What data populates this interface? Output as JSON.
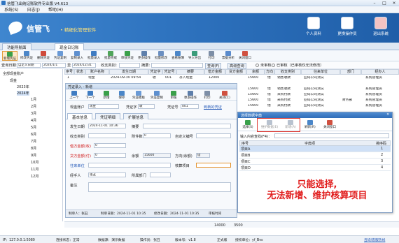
{
  "window": {
    "title": "信管飞出纳记账软件专业版 V4.613",
    "controls": [
      "–",
      "□",
      "×"
    ]
  },
  "menu": [
    "系统(S)",
    "日志(J)",
    "帮助(H)"
  ],
  "banner": {
    "brand": "信管飞",
    "slogan": "• 精细化管理软件",
    "buttons": [
      "个人资料",
      "更换操作员",
      "退出系统"
    ]
  },
  "tabs": [
    "功能导航面",
    "现金日记账"
  ],
  "toolbar": [
    "新增凭证",
    "修改凭证",
    "删除凭证",
    "凭证复制",
    "复制录入",
    "批量录入",
    "批量完成",
    "审核凭证",
    "更多操作",
    "批量修改",
    "查看账簿",
    "导入导出",
    "打印",
    "票据分析",
    "关闭窗口"
  ],
  "filter": {
    "period_label": "查询日期：",
    "period_value": "自定义日期",
    "date_from": "2024/1/1",
    "to_label": "至",
    "date_to": "2024/12/31",
    "class_label": "收支类别：",
    "summary_label": "摘要：",
    "query_btn": "查询(F)",
    "reset_btn": "高级查询",
    "unreviewed": "未审核",
    "reviewed": "已审核（已审核仅无法修改）"
  },
  "tree": {
    "root": "全部现金账户",
    "account": "现金",
    "years": [
      "2023年",
      "2024年"
    ],
    "months": [
      "1月",
      "2月",
      "3月",
      "4月",
      "5月",
      "6月",
      "7月",
      "8月",
      "9月",
      "10月",
      "11月",
      "12月"
    ]
  },
  "grid": {
    "headers": [
      "序号",
      "状态",
      "账户名称",
      "发生日期",
      "凭证字",
      "凭证号",
      "摘要",
      "借方金额",
      "贷方金额",
      "余额",
      "方向",
      "收支类别",
      "往来单位",
      "部门",
      "经办人"
    ],
    "first_row": [
      "1",
      "",
      "现金",
      "2024-09-30 09:54",
      "收",
      "001",
      "存入现金",
      "12000",
      "",
      "15600",
      "借",
      "销售收款",
      "亚码公司测试",
      "",
      "系统管理员"
    ],
    "right_rows": [
      [
        "15600",
        "借",
        "销售收款",
        "亚码公司测试",
        "",
        "系统管理员"
      ],
      [
        "15600",
        "借",
        "采购付款",
        "亚码公司测试",
        "",
        "系统管理员"
      ],
      [
        "15600",
        "借",
        "采购付款",
        "亚码公司测试",
        "财务部",
        "系统管理员"
      ],
      [
        "15600",
        "借",
        "采购付款",
        "亚码公司测试",
        "",
        "系统管理员"
      ]
    ]
  },
  "voucher": {
    "title": "凭证录入 - 新增",
    "toolbar": [
      "上一个",
      "下一个",
      "新增",
      "保存",
      "凭证模板",
      "凭证复制",
      "审核",
      "更多操作",
      "打印",
      "关闭(C)"
    ],
    "account_label": "现金账户",
    "account_value": "现金",
    "vword_label": "凭证字",
    "vword_value": "收",
    "vno_label": "凭证号",
    "vno_value": "001",
    "extra_link": "到新的凭证",
    "tabs": [
      "基本信息",
      "凭证明细",
      "扩展信息"
    ],
    "date_label": "发生日期",
    "date_value": "2024-11-01 10:36",
    "summary_label": "摘要",
    "class_label": "收支类别",
    "attach_label": "附件数",
    "attach_value": "0",
    "custom_label": "自定义编号",
    "debit_label": "借方金额(收)",
    "debit_value": "0",
    "credit_label": "贷方金额(付)",
    "credit_value": "0",
    "balance_label": "余额",
    "balance_value": "15600",
    "dir_label": "方向(余额)",
    "dir_value": "借",
    "partner_label": "往来单位",
    "settle_label": "核算项目",
    "handler_label": "经手人",
    "handler_value": "张丑",
    "dept_label": "所属部门",
    "remark_label": "备注",
    "footer_maker": "制单人：张丑",
    "footer_make_time": "制单日期：2024-11-01 10:35",
    "footer_modify_time": "修改日期：2024-11-01 10:35",
    "footer_review": "审核时间"
  },
  "picker": {
    "title": "选择数据字典",
    "buttons": [
      "选择(S)",
      "维护数据(E)",
      "新增(A)",
      "刷新(R)",
      "关闭窗口"
    ],
    "search_label": "输入内容查找(F4)：",
    "col_index": "序号",
    "col_name": "字典项",
    "col_order": "排序码",
    "rows": [
      {
        "name": "项目A",
        "order": "1"
      },
      {
        "name": "项目B",
        "order": "2"
      },
      {
        "name": "项目C",
        "order": "3"
      },
      {
        "name": "项目D",
        "order": "4"
      }
    ],
    "annotation_line1": "只能选择,",
    "annotation_line2": "无法新增、维护核算项目"
  },
  "totals": {
    "debit": "14000",
    "credit": "3500"
  },
  "status": {
    "ip": "IP：127.0.0.1:5080",
    "conn": "连接状态：正常",
    "db": "数据源：演示数据",
    "user": "操作员：张丑",
    "version": "版本号：v1.8",
    "edition": "正式版",
    "license": "授权单位：yf_Bvs",
    "link": "咨询/客服热线"
  }
}
